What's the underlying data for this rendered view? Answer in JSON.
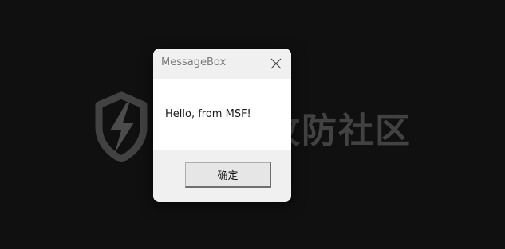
{
  "watermark": {
    "text": "奇安信攻防社区",
    "logo_icon": "lightning-shield-icon"
  },
  "dialog": {
    "title": "MessageBox",
    "close_icon": "close-icon",
    "message": "Hello, from MSF!",
    "ok_label": "确定"
  },
  "colors": {
    "background": "#101010",
    "dialog_frame": "#f0f0f0",
    "dialog_content": "#ffffff",
    "title_text": "#7a7a7a"
  }
}
